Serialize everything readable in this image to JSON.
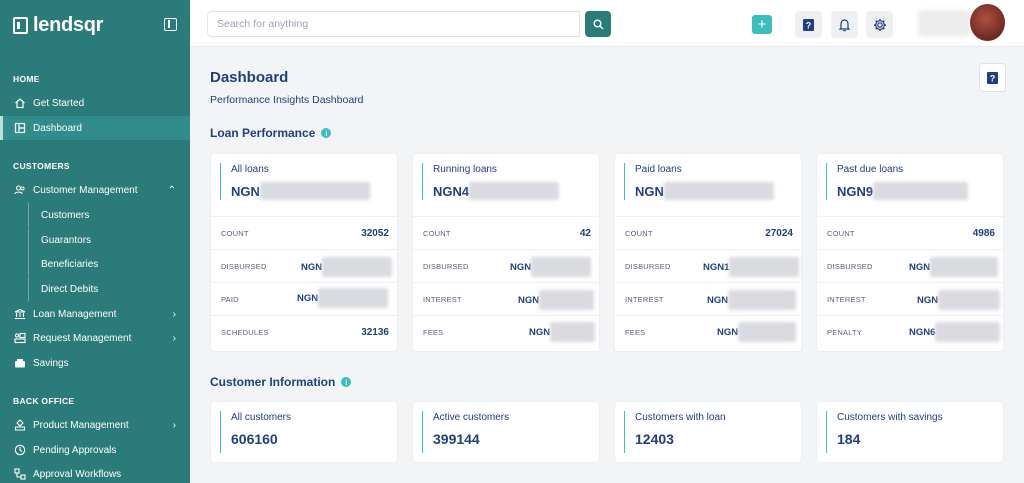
{
  "brand": {
    "name": "lendsqr"
  },
  "search": {
    "placeholder": "Search for anything"
  },
  "sidebar": {
    "sections": {
      "home": "HOME",
      "customers": "CUSTOMERS",
      "back_office": "BACK OFFICE"
    },
    "items": {
      "get_started": "Get Started",
      "dashboard": "Dashboard",
      "customer_management": "Customer Management",
      "customers": "Customers",
      "guarantors": "Guarantors",
      "beneficiaries": "Beneficiaries",
      "direct_debits": "Direct Debits",
      "loan_management": "Loan Management",
      "request_management": "Request Management",
      "savings": "Savings",
      "product_management": "Product Management",
      "pending_approvals": "Pending Approvals",
      "approval_workflows": "Approval Workflows"
    }
  },
  "main": {
    "title": "Dashboard",
    "subtitle": "Performance Insights Dashboard",
    "loan_section": "Loan Performance",
    "customer_section": "Customer Information"
  },
  "loan_cards": [
    {
      "label": "All loans",
      "amount_prefix": "NGN",
      "rows": [
        {
          "label": "COUNT",
          "value": "32052"
        },
        {
          "label": "DISBURSED",
          "value": "NGN"
        },
        {
          "label": "PAID",
          "value": "NGN"
        },
        {
          "label": "SCHEDULES",
          "value": "32136"
        }
      ]
    },
    {
      "label": "Running loans",
      "amount_prefix": "NGN4",
      "rows": [
        {
          "label": "COUNT",
          "value": "42"
        },
        {
          "label": "DISBURSED",
          "value": "NGN"
        },
        {
          "label": "INTEREST",
          "value": "NGN"
        },
        {
          "label": "FEES",
          "value": "NGN"
        }
      ]
    },
    {
      "label": "Paid loans",
      "amount_prefix": "NGN",
      "rows": [
        {
          "label": "COUNT",
          "value": "27024"
        },
        {
          "label": "DISBURSED",
          "value": "NGN1"
        },
        {
          "label": "INTEREST",
          "value": "NGN"
        },
        {
          "label": "FEES",
          "value": "NGN"
        }
      ]
    },
    {
      "label": "Past due loans",
      "amount_prefix": "NGN9",
      "rows": [
        {
          "label": "COUNT",
          "value": "4986"
        },
        {
          "label": "DISBURSED",
          "value": "NGN"
        },
        {
          "label": "INTEREST",
          "value": "NGN"
        },
        {
          "label": "PENALTY",
          "value": "NGN6"
        }
      ]
    }
  ],
  "customer_cards": [
    {
      "label": "All customers",
      "value": "606160"
    },
    {
      "label": "Active customers",
      "value": "399144"
    },
    {
      "label": "Customers with loan",
      "value": "12403"
    },
    {
      "label": "Customers with savings",
      "value": "184"
    }
  ],
  "colors": {
    "sidebar": "#2a7b7a",
    "accent": "#3bbfbd",
    "text": "#213f7d"
  }
}
